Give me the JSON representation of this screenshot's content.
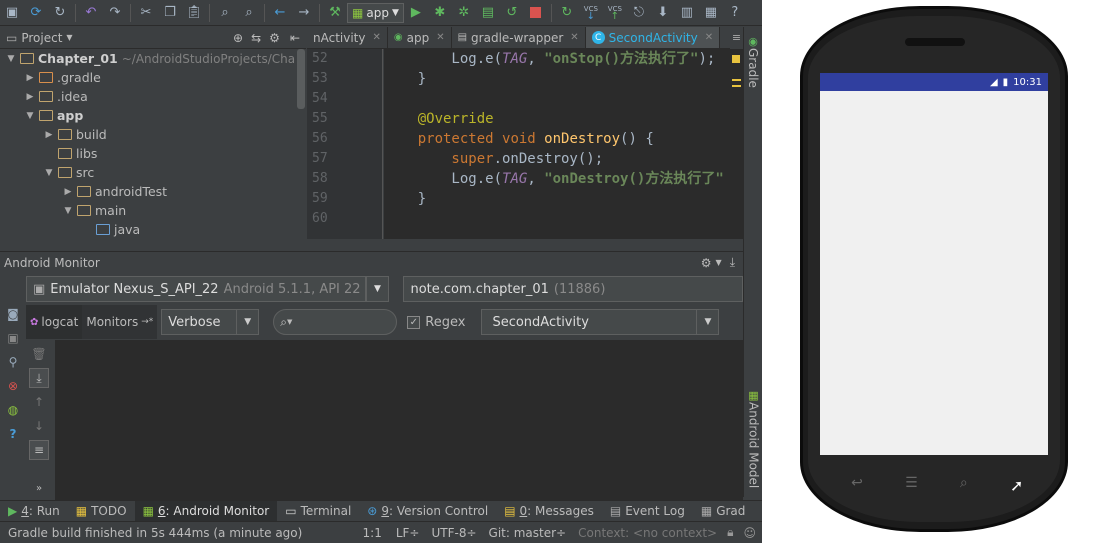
{
  "toolbar": {
    "run_config": "app",
    "vcs1": "VCS",
    "vcs2": "VCS"
  },
  "project_panel": {
    "title": "Project",
    "tree": [
      {
        "label": "Chapter_01",
        "path": "~/AndroidStudioProjects/Chap",
        "depth": 0,
        "expanded": true,
        "bold": true,
        "folder": "yellow"
      },
      {
        "label": ".gradle",
        "depth": 1,
        "expanded": false,
        "folder": "orange"
      },
      {
        "label": ".idea",
        "depth": 1,
        "expanded": false,
        "folder": "yellow"
      },
      {
        "label": "app",
        "depth": 1,
        "expanded": true,
        "bold": true,
        "folder": "yellow"
      },
      {
        "label": "build",
        "depth": 2,
        "expanded": false,
        "folder": "yellow"
      },
      {
        "label": "libs",
        "depth": 2,
        "leaf": true,
        "folder": "yellow"
      },
      {
        "label": "src",
        "depth": 2,
        "expanded": true,
        "folder": "yellow"
      },
      {
        "label": "androidTest",
        "depth": 3,
        "expanded": false,
        "folder": "yellow"
      },
      {
        "label": "main",
        "depth": 3,
        "expanded": true,
        "folder": "yellow"
      },
      {
        "label": "java",
        "depth": 4,
        "leaf": true,
        "folder": "blue"
      }
    ]
  },
  "editor": {
    "tabs": [
      {
        "label": "nActivity",
        "active": false
      },
      {
        "label": "app",
        "active": false
      },
      {
        "label": "gradle-wrapper",
        "active": false
      },
      {
        "label": "SecondActivity",
        "active": true
      }
    ],
    "line_numbers": [
      "52",
      "53",
      "54",
      "55",
      "56",
      "57",
      "58",
      "59",
      "60"
    ],
    "code": {
      "l52_prefix": "        Log.",
      "l52_method": "e",
      "l52_tag": "TAG",
      "l52_str": "\"onStop()方法执行了\"",
      "l52_end": ");",
      "l53": "    }",
      "l55": "    @Override",
      "l56_kw1": "    protected ",
      "l56_kw2": "void ",
      "l56_fn": "onDestroy",
      "l56_end": "() {",
      "l57_kw": "        super",
      "l57_rest": ".onDestroy();",
      "l58_prefix": "        Log.",
      "l58_method": "e",
      "l58_tag": "TAG",
      "l58_str": "\"onDestroy()方法执行了\"",
      "l59": "    }"
    }
  },
  "right_strip": {
    "gradle": "Gradle",
    "android_model": "Android Model"
  },
  "monitor": {
    "title": "Android Monitor",
    "device_name": "Emulator Nexus_S_API_22",
    "device_detail": "Android 5.1.1, API 22",
    "process_name": "note.com.chapter_01",
    "process_pid": "(11886)",
    "logcat_tab": "logcat",
    "monitors_tab": "Monitors",
    "log_level": "Verbose",
    "search_value": "",
    "regex_label": "Regex",
    "regex_checked": true,
    "filter": "SecondActivity"
  },
  "bottom_tabs": [
    {
      "key": "4",
      "label": ": Run"
    },
    {
      "key": "",
      "label": "TODO"
    },
    {
      "key": "6",
      "label": ": Android Monitor",
      "active": true
    },
    {
      "key": "",
      "label": "Terminal"
    },
    {
      "key": "9",
      "label": ": Version Control"
    },
    {
      "key": "0",
      "label": ": Messages"
    },
    {
      "key": "",
      "label": "Event Log"
    },
    {
      "key": "",
      "label": "Grad"
    }
  ],
  "status_bar": {
    "message": "Gradle build finished in 5s 444ms (a minute ago)",
    "position": "1:1",
    "line_sep": "LF÷",
    "encoding": "UTF-8÷",
    "git": "Git: master÷",
    "context": "Context: <no context>"
  },
  "phone": {
    "time": "10:31"
  },
  "colors": {
    "accent_tab": "#2fb5e8",
    "phone_status": "#303f9f"
  }
}
